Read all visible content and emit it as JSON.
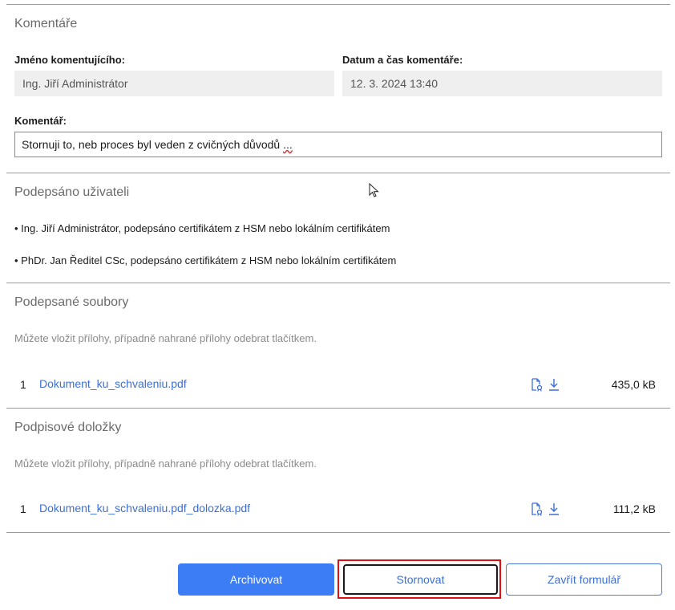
{
  "comments": {
    "title": "Komentáře",
    "commenter_label": "Jméno komentujícího:",
    "commenter_value": "Ing. Jiří Administrátor",
    "datetime_label": "Datum a čas komentáře:",
    "datetime_value": "12. 3. 2024 13:40",
    "comment_label": "Komentář:",
    "comment_value": "Stornuji to, neb proces byl veden z cvičných důvodů",
    "comment_suffix": "..."
  },
  "signed_by": {
    "title": "Podepsáno uživateli",
    "items": [
      "• Ing. Jiří Administrátor, podepsáno certifikátem z HSM nebo lokálním certifikátem",
      "• PhDr. Jan Ředitel CSc, podepsáno certifikátem z HSM nebo lokálním certifikátem"
    ]
  },
  "signed_files": {
    "title": "Podepsané soubory",
    "hint": "Můžete vložit přílohy, případně nahrané přílohy odebrat tlačítkem.",
    "files": [
      {
        "number": "1",
        "name": "Dokument_ku_schvaleniu.pdf",
        "size": "435,0 kB",
        "icons": [
          "file-signature-icon",
          "download-icon"
        ]
      }
    ]
  },
  "signature_clauses": {
    "title": "Podpisové doložky",
    "hint": "Můžete vložit přílohy, případně nahrané přílohy odebrat tlačítkem.",
    "files": [
      {
        "number": "1",
        "name": "Dokument_ku_schvaleniu.pdf_dolozka.pdf",
        "size": "111,2 kB",
        "icons": [
          "file-signature-icon",
          "download-icon"
        ]
      }
    ]
  },
  "buttons": {
    "archive": "Archivovat",
    "cancel": "Stornovat",
    "close": "Zavřít formulář"
  },
  "colors": {
    "accent": "#3c7cf5",
    "link": "#3d6fd6",
    "highlight": "#e01010"
  }
}
